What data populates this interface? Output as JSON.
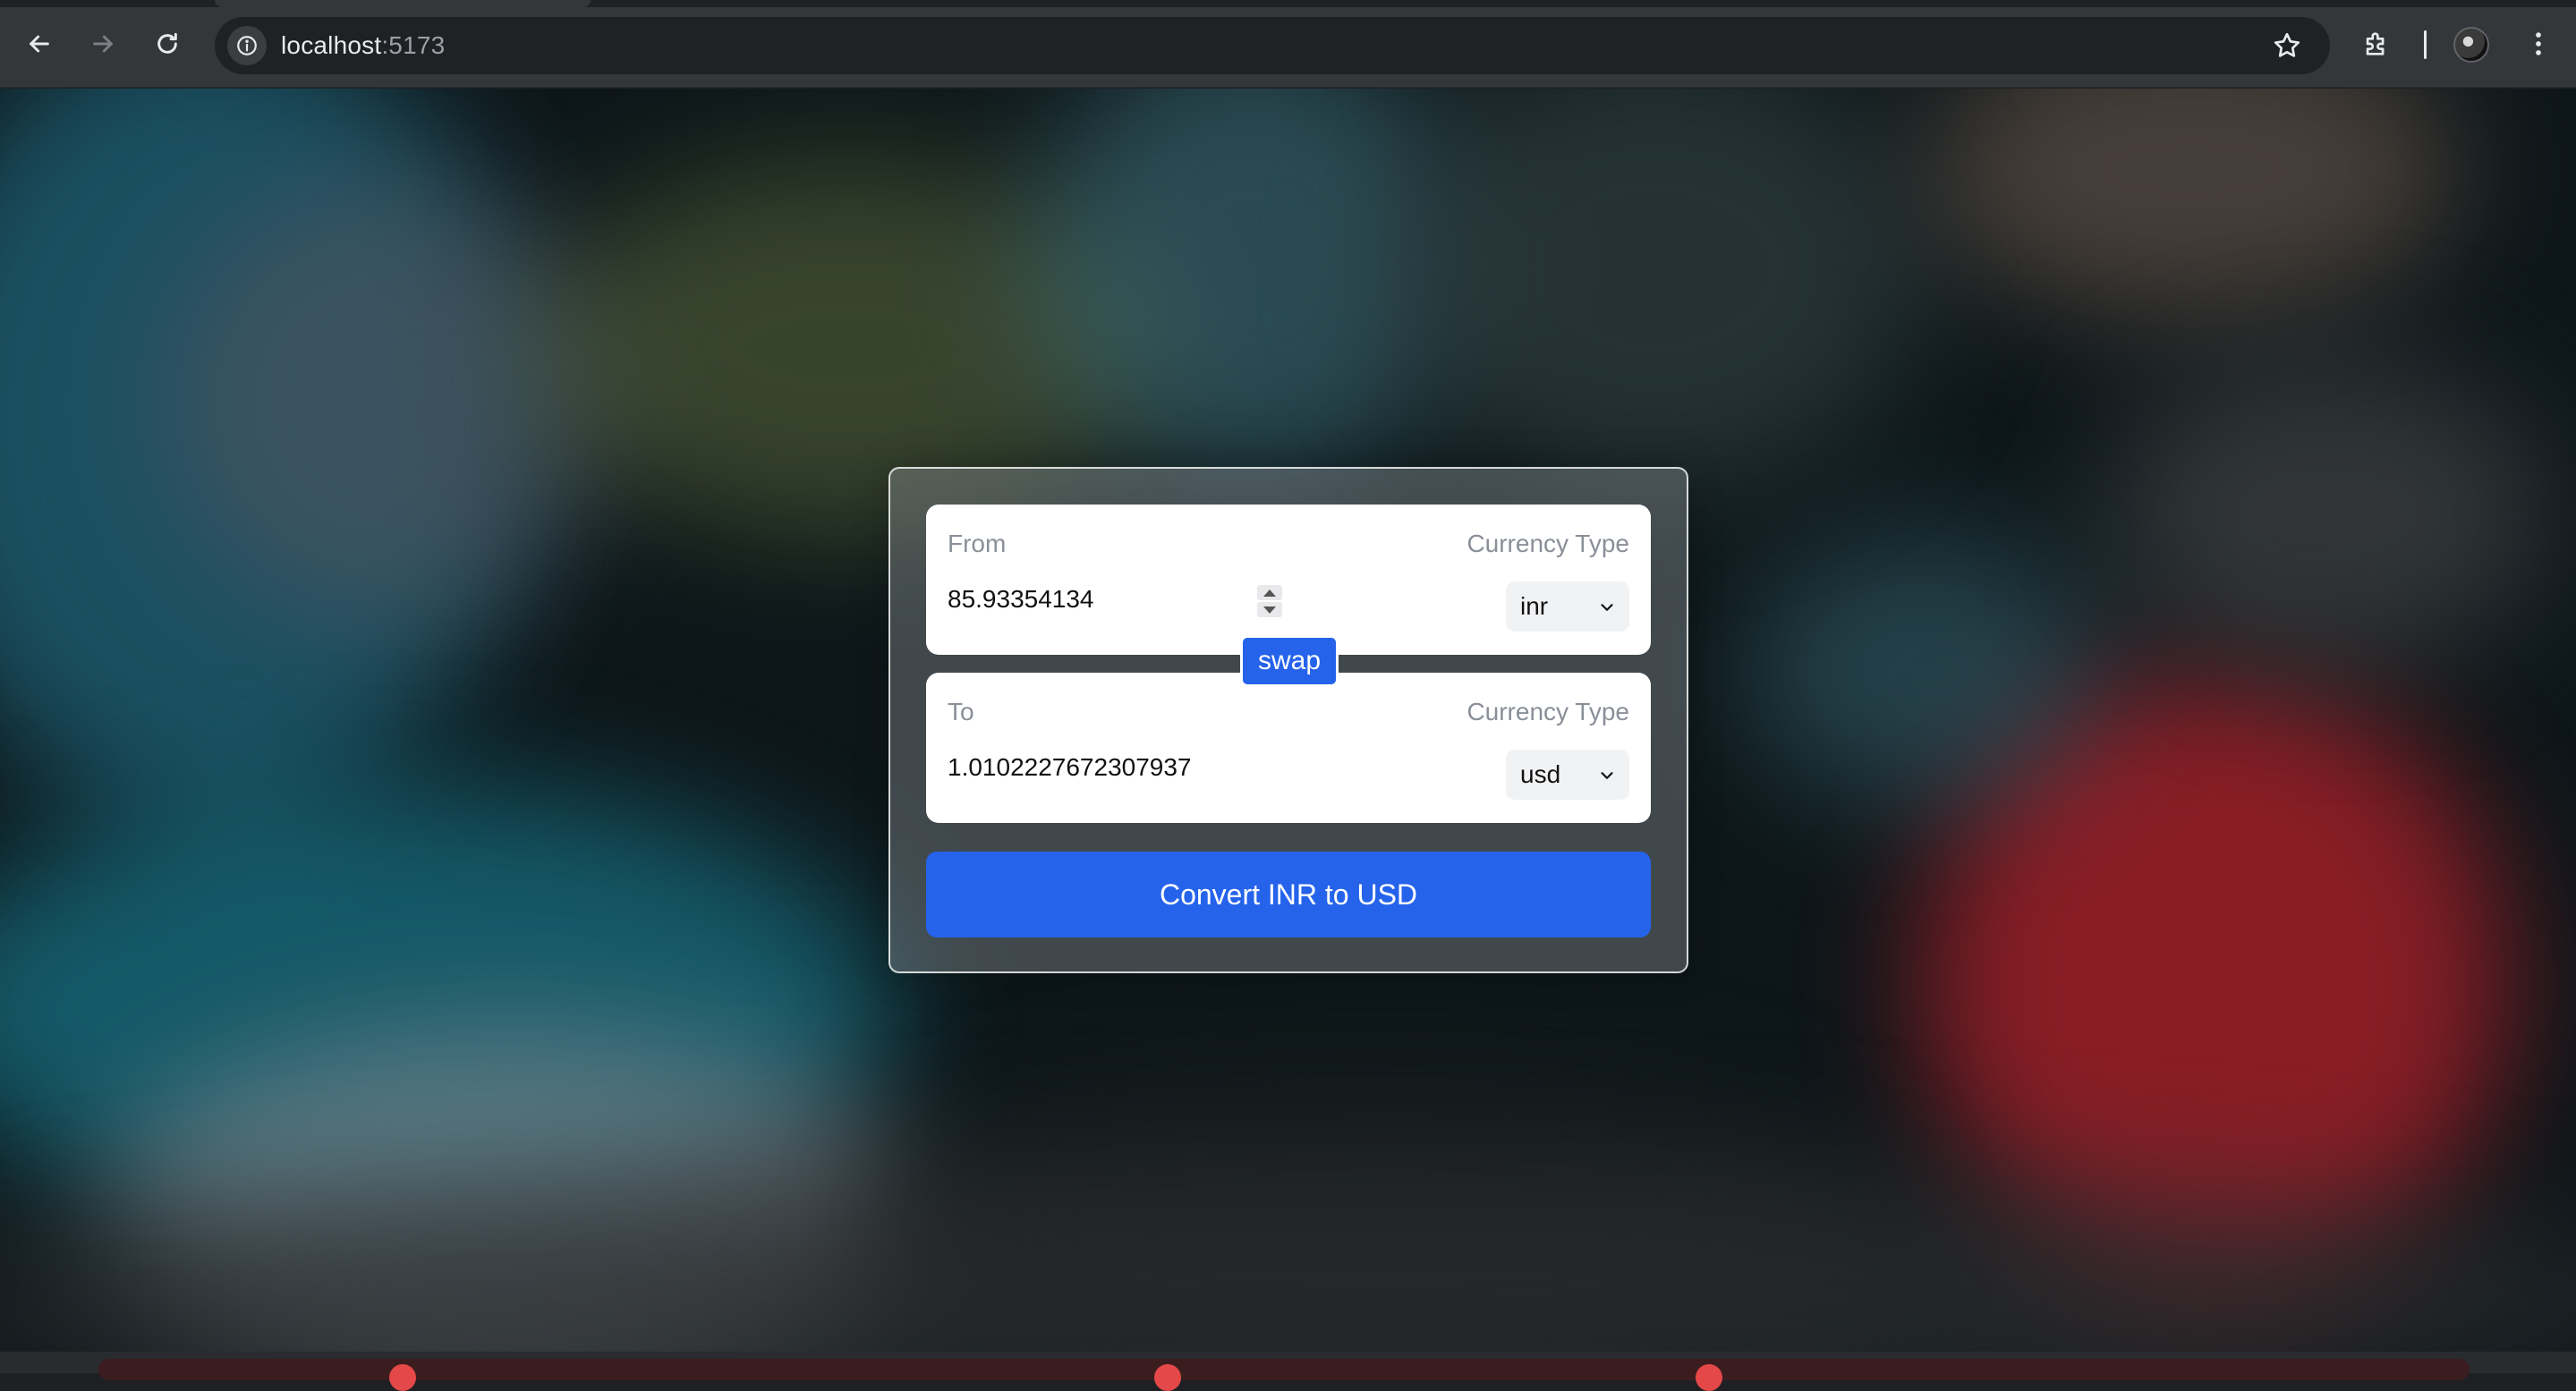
{
  "browser": {
    "url_host": "localhost",
    "url_port": ":5173"
  },
  "converter": {
    "from": {
      "label": "From",
      "type_label": "Currency Type",
      "amount": "85.93354134",
      "currency": "inr"
    },
    "to": {
      "label": "To",
      "type_label": "Currency Type",
      "amount": "1.0102227672307937",
      "currency": "usd"
    },
    "swap_label": "swap",
    "convert_label": "Convert INR to USD",
    "accent_color": "#2563eb"
  },
  "icons": [
    "back-arrow-icon",
    "forward-arrow-icon",
    "reload-icon",
    "info-icon",
    "star-icon",
    "extensions-icon",
    "more-vert-icon",
    "chevron-down-icon"
  ]
}
